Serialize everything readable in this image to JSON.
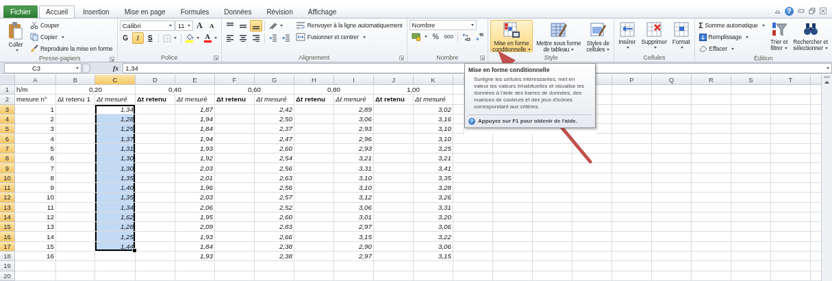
{
  "window_controls": {
    "help": "?"
  },
  "tabs": [
    {
      "label": "Fichier",
      "kind": "file",
      "selected": false
    },
    {
      "label": "Accueil",
      "kind": "tab",
      "selected": true
    },
    {
      "label": "Insertion",
      "kind": "tab",
      "selected": false
    },
    {
      "label": "Mise en page",
      "kind": "tab",
      "selected": false
    },
    {
      "label": "Formules",
      "kind": "tab",
      "selected": false
    },
    {
      "label": "Données",
      "kind": "tab",
      "selected": false
    },
    {
      "label": "Révision",
      "kind": "tab",
      "selected": false
    },
    {
      "label": "Affichage",
      "kind": "tab",
      "selected": false
    }
  ],
  "ribbon": {
    "clipboard": {
      "title": "Presse-papiers",
      "launcher": true,
      "paste": {
        "label": "Coller",
        "dropdown": true
      },
      "cut": {
        "label": "Couper"
      },
      "copy": {
        "label": "Copier",
        "dropdown": true
      },
      "format_painter": {
        "label": "Reproduire la mise en forme"
      }
    },
    "font": {
      "title": "Police",
      "launcher": true,
      "font_name": "Calibri",
      "font_size": "11",
      "grow": "A",
      "shrink": "A",
      "bold": {
        "label": "G",
        "selected": false
      },
      "italic": {
        "label": "I",
        "selected": true
      },
      "underline": {
        "label": "S",
        "selected": false
      },
      "font_color": "A"
    },
    "alignment": {
      "title": "Alignement",
      "launcher": true,
      "vertical": [
        {
          "selected": false
        },
        {
          "selected": false
        },
        {
          "selected": true
        }
      ],
      "horizontal": [
        {
          "selected": false
        },
        {
          "selected": false
        },
        {
          "selected": false
        }
      ],
      "wrap": "Renvoyer à la ligne automatiquement",
      "merge": {
        "label": "Fusionner et centrer",
        "dropdown": true
      }
    },
    "number": {
      "title": "Nombre",
      "launcher": true,
      "format": "Nombre",
      "percent": "%",
      "thousands": "000"
    },
    "styles": {
      "title": "Style",
      "buttons": [
        {
          "lines": [
            "Mise en forme",
            "conditionnelle"
          ],
          "dropdown": true,
          "selected": true
        },
        {
          "lines": [
            "Mettre sous forme",
            "de tableau"
          ],
          "dropdown": true,
          "selected": false
        },
        {
          "lines": [
            "Styles de",
            "cellules"
          ],
          "dropdown": true,
          "selected": false
        }
      ]
    },
    "cells": {
      "title": "Cellules",
      "buttons": [
        {
          "label": "Insérer",
          "dropdown": true
        },
        {
          "label": "Supprimer",
          "dropdown": true
        },
        {
          "label": "Format",
          "dropdown": true
        }
      ]
    },
    "editing": {
      "title": "Édition",
      "sigma": "Σ",
      "autosum": {
        "label": "Somme automatique",
        "dropdown": true
      },
      "fill": {
        "label": "Remplissage",
        "dropdown": true
      },
      "clear": {
        "label": "Effacer",
        "dropdown": true
      },
      "sort": {
        "lines": [
          "Trier et",
          "filtrer"
        ],
        "dropdown": true
      },
      "find": {
        "lines": [
          "Rechercher et",
          "sélectionner"
        ],
        "dropdown": true
      }
    }
  },
  "formula_bar": {
    "name_box": "C3",
    "fx": "fx",
    "value": "1,34"
  },
  "tooltip": {
    "title": "Mise en forme conditionnelle",
    "body": "Surligne les cellules intéressantes, met en valeur les valeurs inhabituelles et visualise les données à l'aide des barres de données, des nuances de couleurs et des jeux d'icônes correspondant aux critères.",
    "help_icon": "?",
    "help": "Appuyez sur F1 pour obtenir de l'aide."
  },
  "sheet": {
    "columns": [
      {
        "letter": "A",
        "selected": false
      },
      {
        "letter": "B",
        "selected": false
      },
      {
        "letter": "C",
        "selected": true
      },
      {
        "letter": "D",
        "selected": false
      },
      {
        "letter": "E",
        "selected": false
      },
      {
        "letter": "F",
        "selected": false
      },
      {
        "letter": "G",
        "selected": false
      },
      {
        "letter": "H",
        "selected": false
      },
      {
        "letter": "I",
        "selected": false
      },
      {
        "letter": "J",
        "selected": false
      },
      {
        "letter": "K",
        "selected": false
      }
    ],
    "columns_right": [
      {
        "letter": "P",
        "selected": false
      },
      {
        "letter": "Q",
        "selected": false
      },
      {
        "letter": "R",
        "selected": false
      },
      {
        "letter": "S",
        "selected": false
      },
      {
        "letter": "T",
        "selected": false
      }
    ],
    "rows": [
      {
        "header": "1",
        "selected": false,
        "cells": [
          {
            "kind": "label",
            "text": "h/m"
          },
          {
            "kind": "merged",
            "text": "0,20"
          },
          {
            "kind": "merged",
            "text": "0,40"
          },
          {
            "kind": "merged",
            "text": "0,60"
          },
          {
            "kind": "merged",
            "text": "0,80"
          },
          {
            "kind": "merged",
            "text": "1,00"
          }
        ]
      },
      {
        "header": "2",
        "selected": false,
        "cells": [
          {
            "kind": "heading",
            "text": "mesure n°"
          },
          {
            "kind": "heading",
            "text": "Δt retenu 1"
          },
          {
            "kind": "italic_heading",
            "text": "Δt mesuré"
          },
          {
            "kind": "bold_heading",
            "text": "Δt retenu"
          },
          {
            "kind": "italic_heading",
            "text": "Δt mesuré"
          },
          {
            "kind": "bold_heading",
            "text": "Δt retenu"
          },
          {
            "kind": "italic_heading",
            "text": "Δt mesuré"
          },
          {
            "kind": "bold_heading",
            "text": "Δt retenu"
          },
          {
            "kind": "italic_heading",
            "text": "Δt mesuré"
          },
          {
            "kind": "bold_heading",
            "text": "Δt retenu"
          },
          {
            "kind": "italic_heading",
            "text": "Δt mesuré"
          }
        ]
      },
      {
        "header": "3",
        "selected": true,
        "cells": [
          {
            "kind": "number",
            "text": "1"
          },
          {
            "kind": "blank"
          },
          {
            "kind": "measured",
            "text": "1,34"
          },
          {
            "kind": "blank"
          },
          {
            "kind": "measured",
            "text": "1,87"
          },
          {
            "kind": "blank"
          },
          {
            "kind": "measured",
            "text": "2,42"
          },
          {
            "kind": "blank"
          },
          {
            "kind": "measured",
            "text": "2,89"
          },
          {
            "kind": "blank"
          },
          {
            "kind": "measured",
            "text": "3,02"
          }
        ]
      },
      {
        "header": "4",
        "selected": true,
        "cells": [
          {
            "kind": "number",
            "text": "2"
          },
          {
            "kind": "blank"
          },
          {
            "kind": "measured",
            "text": "1,28"
          },
          {
            "kind": "blank"
          },
          {
            "kind": "measured",
            "text": "1,94"
          },
          {
            "kind": "blank"
          },
          {
            "kind": "measured",
            "text": "2,50"
          },
          {
            "kind": "blank"
          },
          {
            "kind": "measured",
            "text": "3,06"
          },
          {
            "kind": "blank"
          },
          {
            "kind": "measured",
            "text": "3,16"
          }
        ]
      },
      {
        "header": "5",
        "selected": true,
        "cells": [
          {
            "kind": "number",
            "text": "3"
          },
          {
            "kind": "blank"
          },
          {
            "kind": "measured",
            "text": "1,25"
          },
          {
            "kind": "blank"
          },
          {
            "kind": "measured",
            "text": "1,84"
          },
          {
            "kind": "blank"
          },
          {
            "kind": "measured",
            "text": "2,37"
          },
          {
            "kind": "blank"
          },
          {
            "kind": "measured",
            "text": "2,93"
          },
          {
            "kind": "blank"
          },
          {
            "kind": "measured",
            "text": "3,10"
          }
        ]
      },
      {
        "header": "6",
        "selected": true,
        "cells": [
          {
            "kind": "number",
            "text": "4"
          },
          {
            "kind": "blank"
          },
          {
            "kind": "measured",
            "text": "1,37"
          },
          {
            "kind": "blank"
          },
          {
            "kind": "measured",
            "text": "1,94"
          },
          {
            "kind": "blank"
          },
          {
            "kind": "measured",
            "text": "2,47"
          },
          {
            "kind": "blank"
          },
          {
            "kind": "measured",
            "text": "2,96"
          },
          {
            "kind": "blank"
          },
          {
            "kind": "measured",
            "text": "3,10"
          }
        ]
      },
      {
        "header": "7",
        "selected": true,
        "cells": [
          {
            "kind": "number",
            "text": "5"
          },
          {
            "kind": "blank"
          },
          {
            "kind": "measured",
            "text": "1,31"
          },
          {
            "kind": "blank"
          },
          {
            "kind": "measured",
            "text": "1,93"
          },
          {
            "kind": "blank"
          },
          {
            "kind": "measured",
            "text": "2,60"
          },
          {
            "kind": "blank"
          },
          {
            "kind": "measured",
            "text": "2,93"
          },
          {
            "kind": "blank"
          },
          {
            "kind": "measured",
            "text": "3,25"
          }
        ]
      },
      {
        "header": "8",
        "selected": true,
        "cells": [
          {
            "kind": "number",
            "text": "6"
          },
          {
            "kind": "blank"
          },
          {
            "kind": "measured",
            "text": "1,30"
          },
          {
            "kind": "blank"
          },
          {
            "kind": "measured",
            "text": "1,92"
          },
          {
            "kind": "blank"
          },
          {
            "kind": "measured",
            "text": "2,54"
          },
          {
            "kind": "blank"
          },
          {
            "kind": "measured",
            "text": "3,21"
          },
          {
            "kind": "blank"
          },
          {
            "kind": "measured",
            "text": "3,21"
          }
        ]
      },
      {
        "header": "9",
        "selected": true,
        "cells": [
          {
            "kind": "number",
            "text": "7"
          },
          {
            "kind": "blank"
          },
          {
            "kind": "measured",
            "text": "1,30"
          },
          {
            "kind": "blank"
          },
          {
            "kind": "measured",
            "text": "2,03"
          },
          {
            "kind": "blank"
          },
          {
            "kind": "measured",
            "text": "2,56"
          },
          {
            "kind": "blank"
          },
          {
            "kind": "measured",
            "text": "3,31"
          },
          {
            "kind": "blank"
          },
          {
            "kind": "measured",
            "text": "3,41"
          }
        ]
      },
      {
        "header": "10",
        "selected": true,
        "cells": [
          {
            "kind": "number",
            "text": "8"
          },
          {
            "kind": "blank"
          },
          {
            "kind": "measured",
            "text": "1,35"
          },
          {
            "kind": "blank"
          },
          {
            "kind": "measured",
            "text": "2,01"
          },
          {
            "kind": "blank"
          },
          {
            "kind": "measured",
            "text": "2,63"
          },
          {
            "kind": "blank"
          },
          {
            "kind": "measured",
            "text": "3,10"
          },
          {
            "kind": "blank"
          },
          {
            "kind": "measured",
            "text": "3,35"
          }
        ]
      },
      {
        "header": "11",
        "selected": true,
        "cells": [
          {
            "kind": "number",
            "text": "9"
          },
          {
            "kind": "blank"
          },
          {
            "kind": "measured",
            "text": "1,40"
          },
          {
            "kind": "blank"
          },
          {
            "kind": "measured",
            "text": "1,96"
          },
          {
            "kind": "blank"
          },
          {
            "kind": "measured",
            "text": "2,56"
          },
          {
            "kind": "blank"
          },
          {
            "kind": "measured",
            "text": "3,10"
          },
          {
            "kind": "blank"
          },
          {
            "kind": "measured",
            "text": "3,28"
          }
        ]
      },
      {
        "header": "12",
        "selected": true,
        "cells": [
          {
            "kind": "number",
            "text": "10"
          },
          {
            "kind": "blank"
          },
          {
            "kind": "measured",
            "text": "1,35"
          },
          {
            "kind": "blank"
          },
          {
            "kind": "measured",
            "text": "2,03"
          },
          {
            "kind": "blank"
          },
          {
            "kind": "measured",
            "text": "2,57"
          },
          {
            "kind": "blank"
          },
          {
            "kind": "measured",
            "text": "3,12"
          },
          {
            "kind": "blank"
          },
          {
            "kind": "measured",
            "text": "3,26"
          }
        ]
      },
      {
        "header": "13",
        "selected": true,
        "cells": [
          {
            "kind": "number",
            "text": "11"
          },
          {
            "kind": "blank"
          },
          {
            "kind": "measured",
            "text": "1,34"
          },
          {
            "kind": "blank"
          },
          {
            "kind": "measured",
            "text": "2,06"
          },
          {
            "kind": "blank"
          },
          {
            "kind": "measured",
            "text": "2,52"
          },
          {
            "kind": "blank"
          },
          {
            "kind": "measured",
            "text": "3,06"
          },
          {
            "kind": "blank"
          },
          {
            "kind": "measured",
            "text": "3,31"
          }
        ]
      },
      {
        "header": "14",
        "selected": true,
        "cells": [
          {
            "kind": "number",
            "text": "12"
          },
          {
            "kind": "blank"
          },
          {
            "kind": "measured",
            "text": "1,62"
          },
          {
            "kind": "blank"
          },
          {
            "kind": "measured",
            "text": "1,95"
          },
          {
            "kind": "blank"
          },
          {
            "kind": "measured",
            "text": "2,60"
          },
          {
            "kind": "blank"
          },
          {
            "kind": "measured",
            "text": "3,01"
          },
          {
            "kind": "blank"
          },
          {
            "kind": "measured",
            "text": "3,20"
          }
        ]
      },
      {
        "header": "15",
        "selected": true,
        "cells": [
          {
            "kind": "number",
            "text": "13"
          },
          {
            "kind": "blank"
          },
          {
            "kind": "measured",
            "text": "1,28"
          },
          {
            "kind": "blank"
          },
          {
            "kind": "measured",
            "text": "2,09"
          },
          {
            "kind": "blank"
          },
          {
            "kind": "measured",
            "text": "2,83"
          },
          {
            "kind": "blank"
          },
          {
            "kind": "measured",
            "text": "2,97"
          },
          {
            "kind": "blank"
          },
          {
            "kind": "measured",
            "text": "3,06"
          }
        ]
      },
      {
        "header": "16",
        "selected": true,
        "cells": [
          {
            "kind": "number",
            "text": "14"
          },
          {
            "kind": "blank"
          },
          {
            "kind": "measured",
            "text": "1,25"
          },
          {
            "kind": "blank"
          },
          {
            "kind": "measured",
            "text": "1,93"
          },
          {
            "kind": "blank"
          },
          {
            "kind": "measured",
            "text": "2,66"
          },
          {
            "kind": "blank"
          },
          {
            "kind": "measured",
            "text": "3,15"
          },
          {
            "kind": "blank"
          },
          {
            "kind": "measured",
            "text": "3,22"
          }
        ]
      },
      {
        "header": "17",
        "selected": true,
        "cells": [
          {
            "kind": "number",
            "text": "15"
          },
          {
            "kind": "blank"
          },
          {
            "kind": "measured",
            "text": "1,44"
          },
          {
            "kind": "blank"
          },
          {
            "kind": "measured",
            "text": "1,84"
          },
          {
            "kind": "blank"
          },
          {
            "kind": "measured",
            "text": "2,38"
          },
          {
            "kind": "blank"
          },
          {
            "kind": "measured",
            "text": "2,90"
          },
          {
            "kind": "blank"
          },
          {
            "kind": "measured",
            "text": "3,06"
          }
        ]
      },
      {
        "header": "18",
        "selected": false,
        "cells": [
          {
            "kind": "number",
            "text": "16"
          },
          {
            "kind": "blank"
          },
          {
            "kind": "blank"
          },
          {
            "kind": "blank"
          },
          {
            "kind": "measured",
            "text": "1,93"
          },
          {
            "kind": "blank"
          },
          {
            "kind": "measured",
            "text": "2,38"
          },
          {
            "kind": "blank"
          },
          {
            "kind": "measured",
            "text": "2,97"
          },
          {
            "kind": "blank"
          },
          {
            "kind": "measured",
            "text": "3,15"
          }
        ]
      },
      {
        "header": "19",
        "selected": false
      },
      {
        "header": "20",
        "selected": false
      }
    ]
  }
}
